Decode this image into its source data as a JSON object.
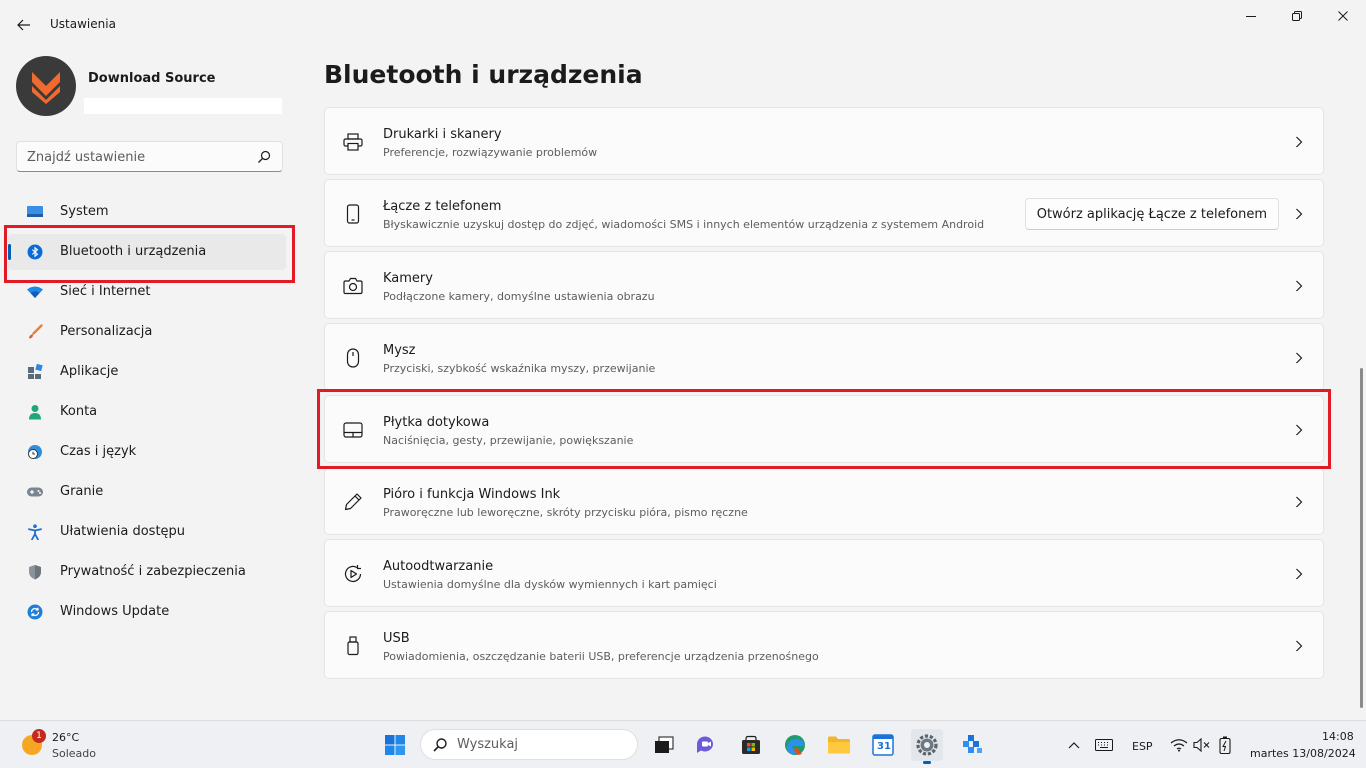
{
  "window": {
    "app_title": "Ustawienia"
  },
  "profile": {
    "name": "Download Source",
    "email": ""
  },
  "search": {
    "placeholder": "Znajdź ustawienie"
  },
  "nav": {
    "items": [
      {
        "label": "System",
        "icon": "monitor-icon"
      },
      {
        "label": "Bluetooth i urządzenia",
        "icon": "bluetooth-icon",
        "active": true
      },
      {
        "label": "Sieć i Internet",
        "icon": "wifi-icon"
      },
      {
        "label": "Personalizacja",
        "icon": "brush-icon"
      },
      {
        "label": "Aplikacje",
        "icon": "apps-icon"
      },
      {
        "label": "Konta",
        "icon": "person-icon"
      },
      {
        "label": "Czas i język",
        "icon": "clock-globe-icon"
      },
      {
        "label": "Granie",
        "icon": "gamepad-icon"
      },
      {
        "label": "Ułatwienia dostępu",
        "icon": "accessibility-icon"
      },
      {
        "label": "Prywatność i zabezpieczenia",
        "icon": "shield-icon"
      },
      {
        "label": "Windows Update",
        "icon": "update-icon"
      }
    ]
  },
  "main": {
    "title": "Bluetooth i urządzenia",
    "cards": [
      {
        "title": "Drukarki i skanery",
        "desc": "Preferencje, rozwiązywanie problemów",
        "icon": "printer-icon"
      },
      {
        "title": "Łącze z telefonem",
        "desc": "Błyskawicznie uzyskuj dostęp do zdjęć, wiadomości SMS i innych elementów urządzenia z systemem Android",
        "icon": "phone-icon",
        "action": "Otwórz aplikację Łącze z telefonem"
      },
      {
        "title": "Kamery",
        "desc": "Podłączone kamery, domyślne ustawienia obrazu",
        "icon": "camera-icon"
      },
      {
        "title": "Mysz",
        "desc": "Przyciski, szybkość wskaźnika myszy, przewijanie",
        "icon": "mouse-icon"
      },
      {
        "title": "Płytka dotykowa",
        "desc": "Naciśnięcia, gesty, przewijanie, powiększanie",
        "icon": "touchpad-icon"
      },
      {
        "title": "Pióro i funkcja Windows Ink",
        "desc": "Praworęczne lub leworęczne, skróty przycisku pióra, pismo ręczne",
        "icon": "pen-icon"
      },
      {
        "title": "Autoodtwarzanie",
        "desc": "Ustawienia domyślne dla dysków wymiennych i kart pamięci",
        "icon": "autoplay-icon"
      },
      {
        "title": "USB",
        "desc": "Powiadomienia, oszczędzanie baterii USB, preferencje urządzenia przenośnego",
        "icon": "usb-icon"
      }
    ]
  },
  "taskbar": {
    "weather": {
      "temp": "26°C",
      "desc": "Soleado",
      "badge": "1"
    },
    "search_placeholder": "Wyszukaj",
    "calendar_day": "31",
    "language": "ESP",
    "time": "14:08",
    "date": "martes 13/08/2024"
  },
  "colors": {
    "accent": "#005fb8",
    "highlight_box": "#e01b24"
  }
}
